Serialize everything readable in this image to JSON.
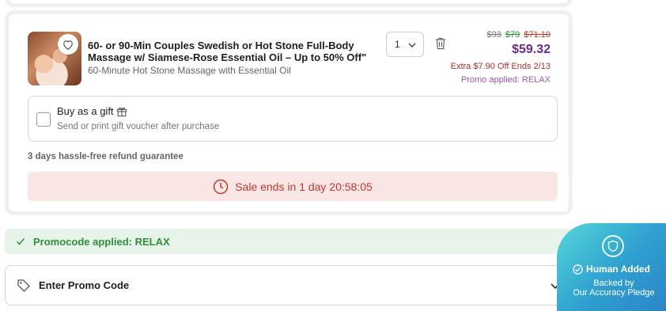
{
  "deal": {
    "title": "60- or 90-Min Couples Swedish or Hot Stone Full-Body Massage w/ Siamese-Rose Essential Oil – Up to 50% Off\"",
    "option": "60-Minute Hot Stone Massage with Essential Oil",
    "image_icon": "massage-photo",
    "quantity": "1",
    "prices": {
      "original": "$93",
      "was_green": "$79",
      "was_red": "$71.10",
      "final": "$59.32"
    },
    "extra_off": "Extra $7.90 Off Ends 2/13",
    "promo_applied": "Promo applied: RELAX"
  },
  "gift": {
    "title": "Buy as a gift",
    "subtitle": "Send or print gift voucher after purchase",
    "checked": false
  },
  "refund": "3 days hassle-free refund guarantee",
  "sale": {
    "text": "Sale ends in 1 day 20:58:05"
  },
  "promo_bar": {
    "text": "Promocode applied: RELAX"
  },
  "promo_input": {
    "label": "Enter Promo Code"
  },
  "pledge": {
    "title": "Human Added",
    "sub_line1": "Backed by",
    "sub_line2": "Our Accuracy Pledge"
  },
  "colors": {
    "final_price": "#6c2a8a",
    "sale_red": "#c0392b",
    "success_green": "#2f8f3a",
    "pledge_gradient_start": "#55d6d8",
    "pledge_gradient_end": "#2b86c7"
  }
}
